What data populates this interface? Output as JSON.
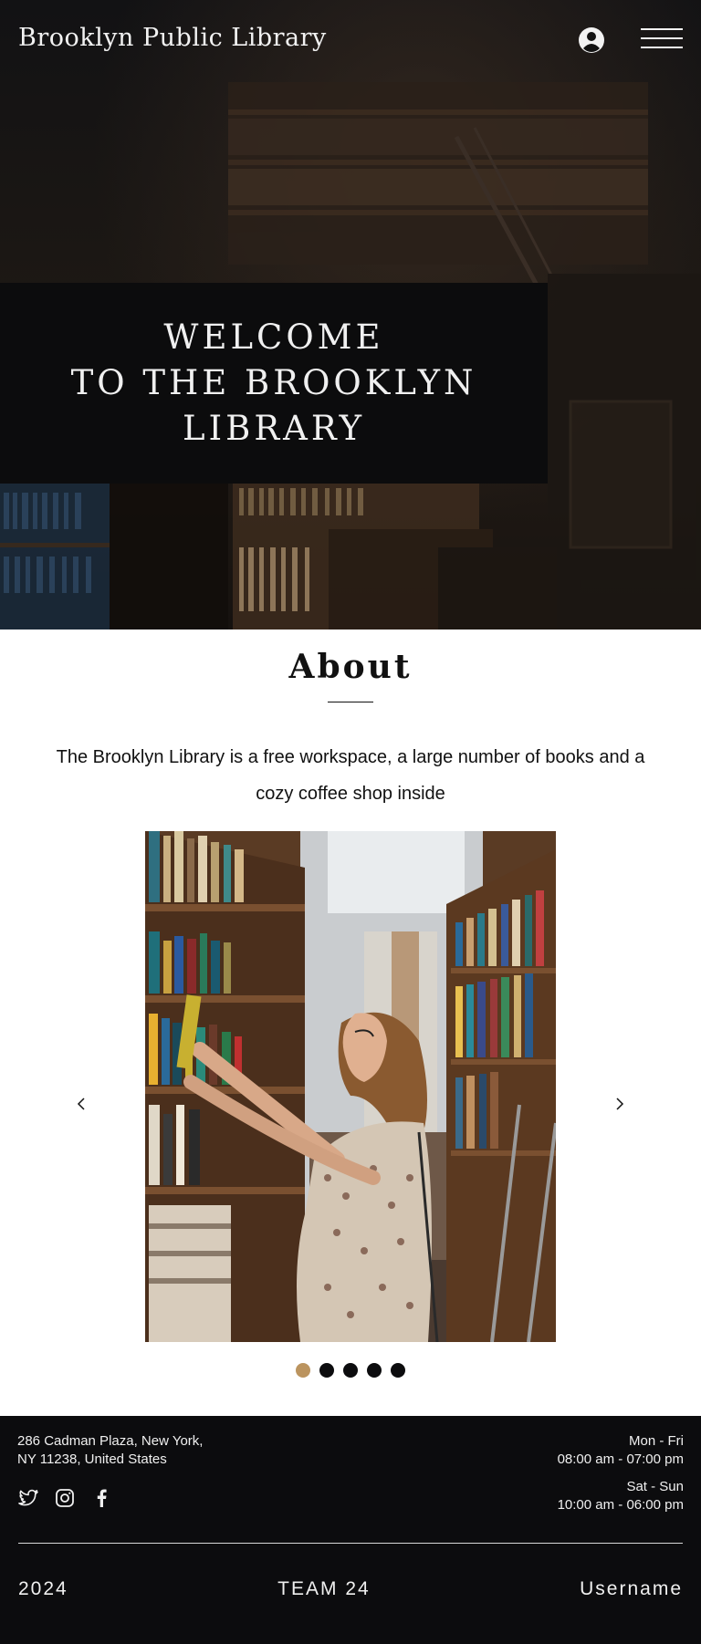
{
  "header": {
    "site_title": "Brooklyn Public Library",
    "profile_icon": "user-circle-icon",
    "menu_icon": "hamburger-menu-icon"
  },
  "hero": {
    "welcome_lines": [
      "WELCOME",
      "TO THE BROOKLYN",
      "LIBRARY"
    ]
  },
  "about": {
    "title": "About",
    "text_lines": [
      "The Brooklyn Library is a free workspace, a large number of books and a",
      "cozy coffee shop inside"
    ],
    "carousel": {
      "prev_icon": "chevron-left-icon",
      "next_icon": "chevron-right-icon",
      "slide_count": 5,
      "active_index": 0
    }
  },
  "footer": {
    "address_lines": [
      "286 Cadman Plaza, New York,",
      "NY 11238, United States"
    ],
    "socials": [
      "twitter-icon",
      "instagram-icon",
      "facebook-icon"
    ],
    "hours": [
      {
        "days": "Mon - Fri",
        "time": "08:00 am - 07:00 pm"
      },
      {
        "days": "Sat - Sun",
        "time": "10:00 am - 06:00 pm"
      }
    ],
    "year": "2024",
    "team": "TEAM 24",
    "username": "Username"
  },
  "colors": {
    "background_dark": "#0c0c0e",
    "accent_gold": "#bb945f",
    "text_light": "#f0f0f0"
  }
}
